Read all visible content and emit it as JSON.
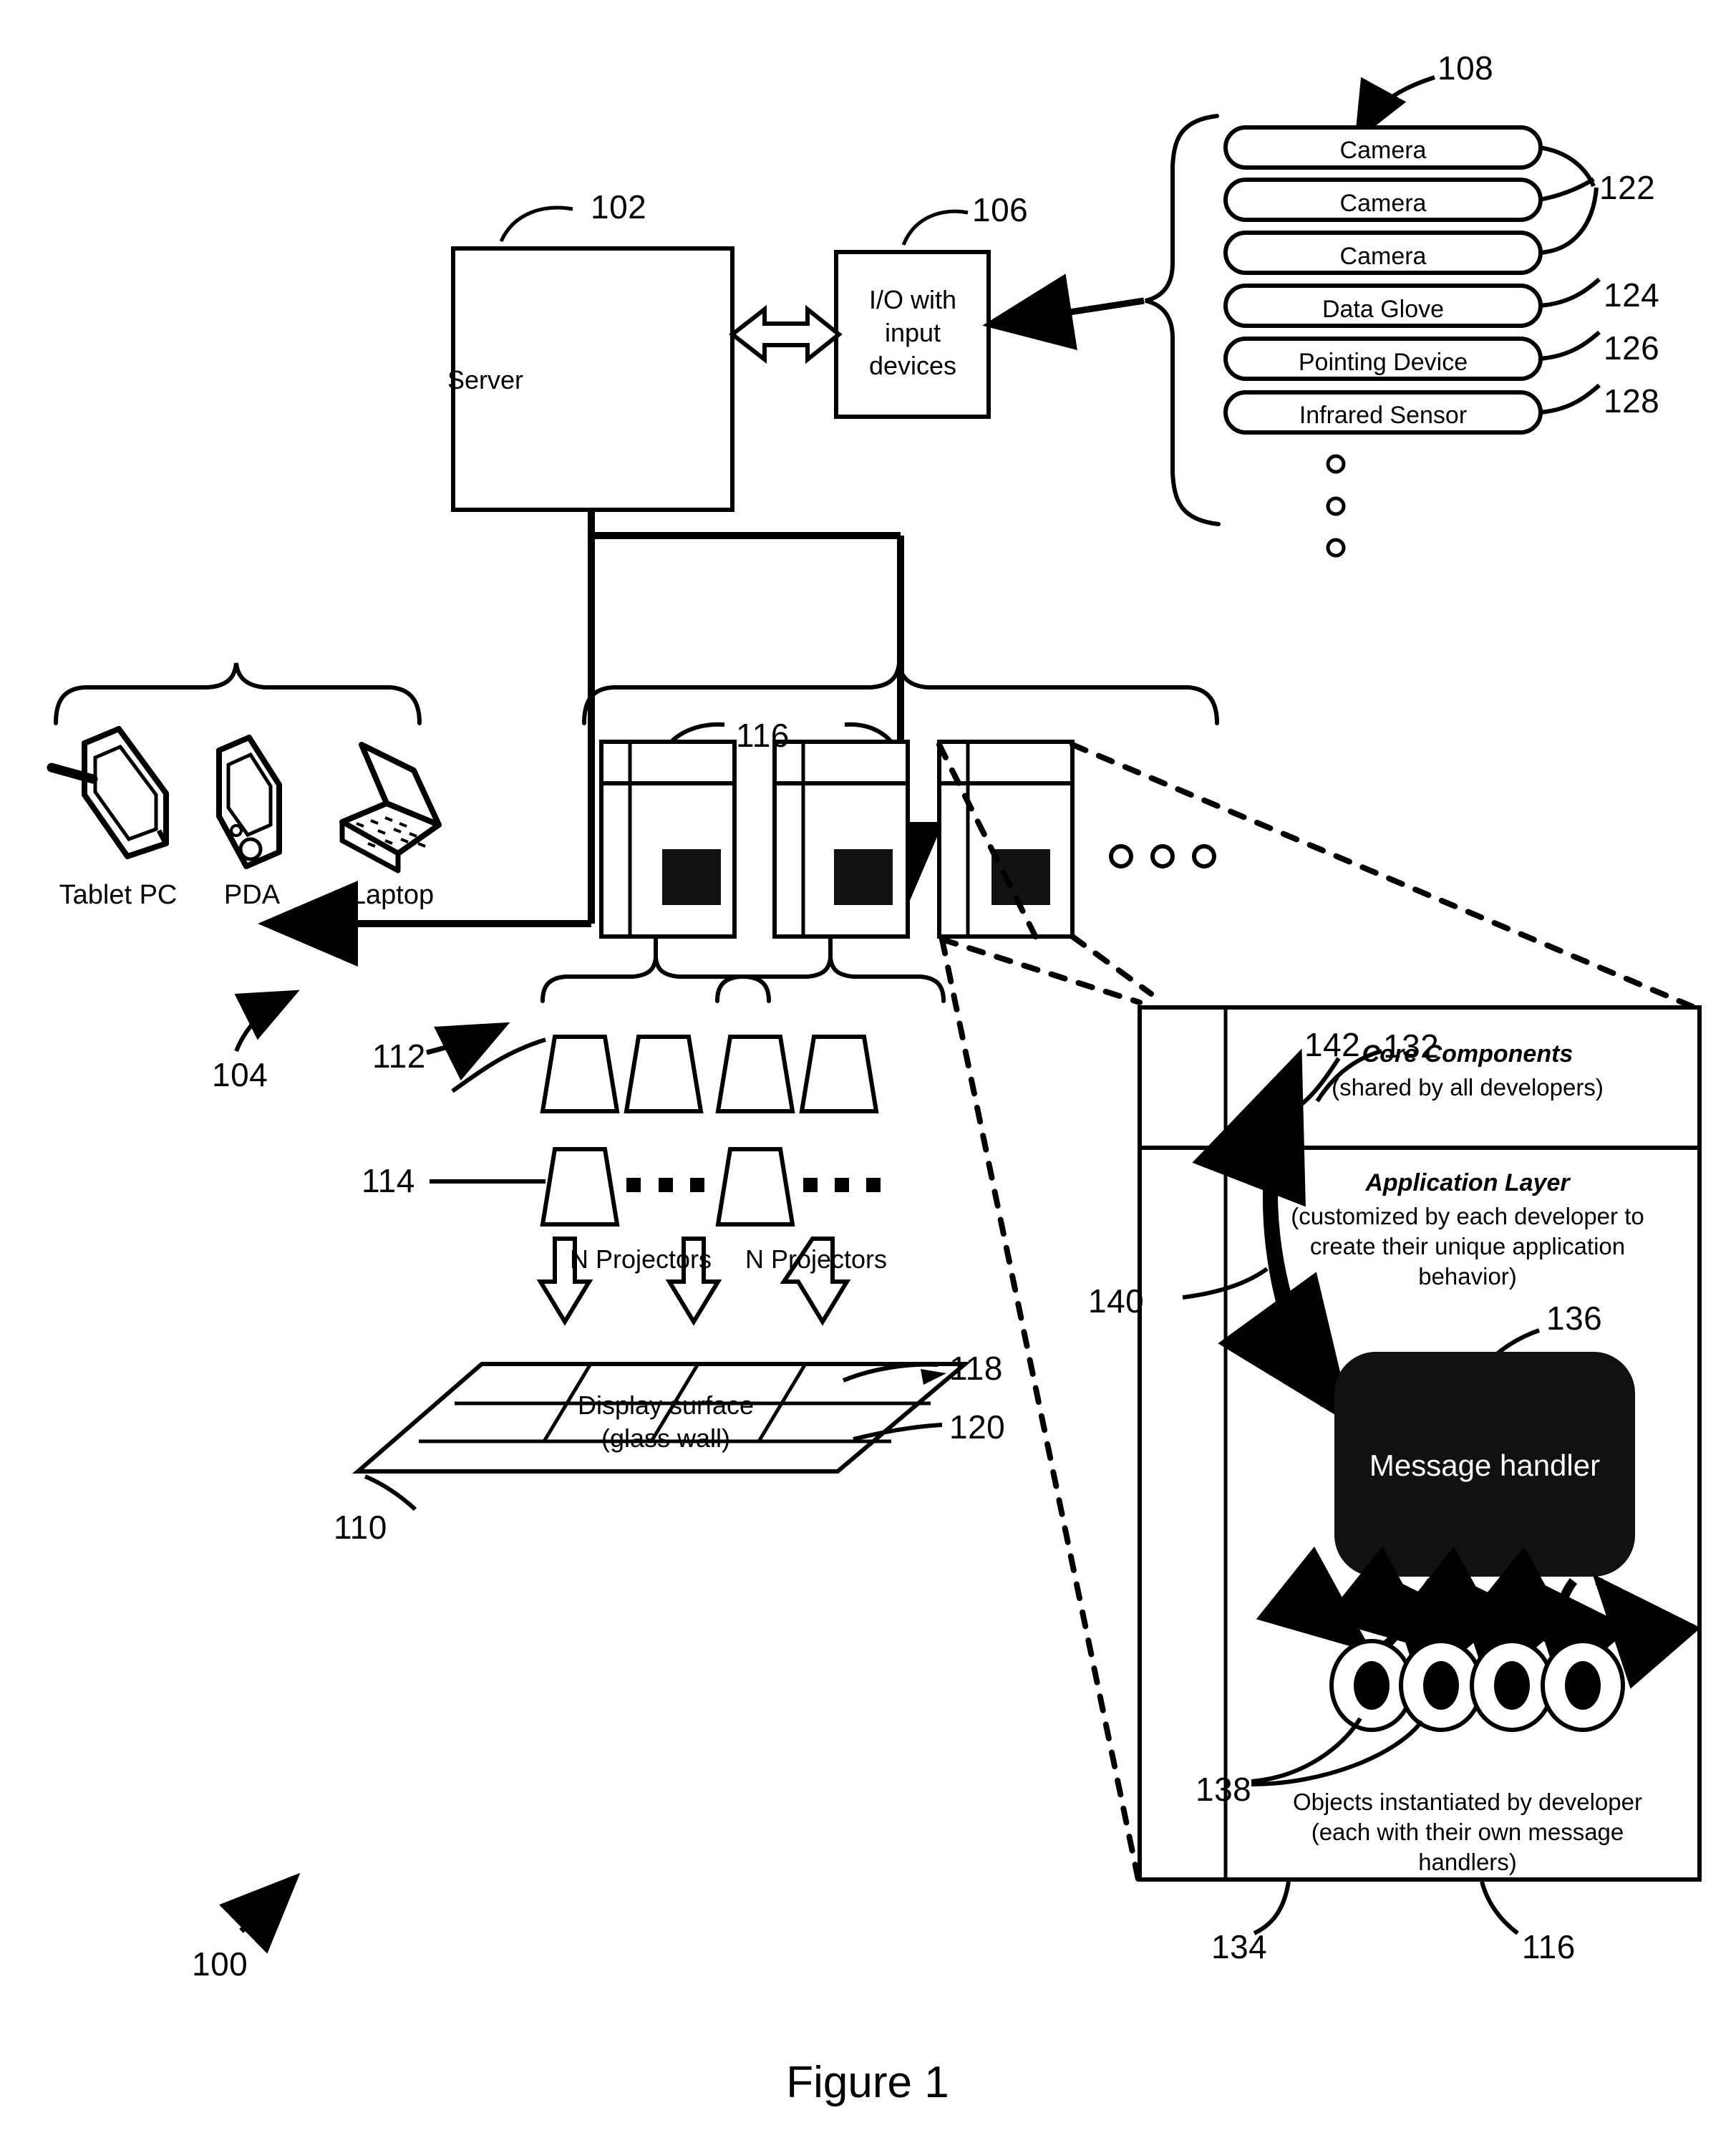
{
  "figure": {
    "caption": "Figure 1",
    "system_ref": "100"
  },
  "server_block": {
    "label": "Server",
    "ref": "102"
  },
  "io_block": {
    "label": "I/O with\ninput\ndevices",
    "line1": "I/O with",
    "line2": "input",
    "line3": "devices",
    "ref": "106"
  },
  "input_devices": {
    "group_ref": "108",
    "items": [
      {
        "label": "Camera",
        "ref": "122"
      },
      {
        "label": "Camera",
        "ref": ""
      },
      {
        "label": "Camera",
        "ref": ""
      },
      {
        "label": "Data Glove",
        "ref": "124"
      },
      {
        "label": "Pointing Device",
        "ref": "126"
      },
      {
        "label": "Infrared Sensor",
        "ref": "128"
      }
    ],
    "ellipsis_glyph": "o",
    "ellipsis_count": 3
  },
  "client_devices": {
    "group_ref": "104",
    "items": [
      {
        "label": "Tablet PC",
        "icon": "tablet-pc-icon"
      },
      {
        "label": "PDA",
        "icon": "pda-icon"
      },
      {
        "label": "Laptop",
        "icon": "laptop-icon"
      }
    ]
  },
  "display_cluster": {
    "pc_ref": "116",
    "pc_count": 3,
    "ellipsis_glyph": "o",
    "ellipsis_count": 3,
    "projector_groups": [
      {
        "label": "N Projectors",
        "ref_group": "112",
        "ref_unit": "114"
      },
      {
        "label": "N Projectors",
        "ref_group": "",
        "ref_unit": ""
      }
    ],
    "arrow_count": 3
  },
  "display_surface": {
    "line1": "Display surface",
    "line2": "(glass wall)",
    "ref_surface": "110",
    "ref_tile": "118",
    "ref_edge": "120"
  },
  "detail_panel": {
    "pc_ref_bottom": "116",
    "core_ref": "132",
    "app_ref": "134",
    "sidebar_ref": "140",
    "arrow_ref": "142",
    "core": {
      "title": "Core Components",
      "subtitle": "(shared by all developers)"
    },
    "application": {
      "title": "Application Layer",
      "subtitle_line1": "(customized by each developer to",
      "subtitle_line2": "create their unique application",
      "subtitle_line3": "behavior)"
    },
    "message_handler": {
      "label": "Message handler",
      "ref": "136"
    },
    "objects": {
      "ref": "138",
      "count": 4,
      "caption_line1": "Objects instantiated by developer",
      "caption_line2": "(each with their own message",
      "caption_line3": "handlers)"
    }
  },
  "colors": {
    "ink": "#000000",
    "paper": "#ffffff",
    "fill_dark": "#111111"
  }
}
